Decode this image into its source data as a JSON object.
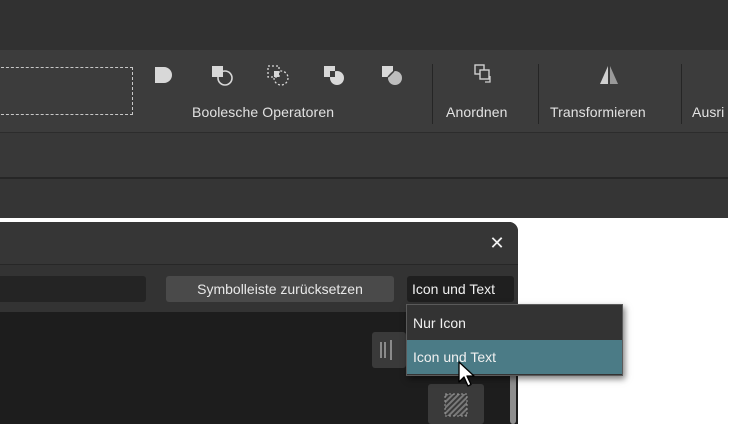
{
  "toolbar": {
    "groups": [
      {
        "label": "Boolesche Operatoren"
      },
      {
        "label": "Anordnen"
      },
      {
        "label": "Transformieren"
      },
      {
        "label": "Ausri"
      }
    ],
    "icons": [
      "add-shape-icon",
      "subtract-shape-icon",
      "intersect-shape-icon",
      "xor-shape-icon",
      "divide-shape-icon",
      "arrange-icon",
      "flip-icon"
    ]
  },
  "dialog": {
    "reset_button_label": "Symbolleiste zurücksetzen",
    "display_mode_value": "Icon und Text",
    "close_icon": "close-icon"
  },
  "dropdown": {
    "options": [
      "Nur Icon",
      "Icon und Text"
    ],
    "highlighted_index": 1
  },
  "colors": {
    "highlight": "#4b7b86",
    "panel": "#3c3c3c"
  }
}
